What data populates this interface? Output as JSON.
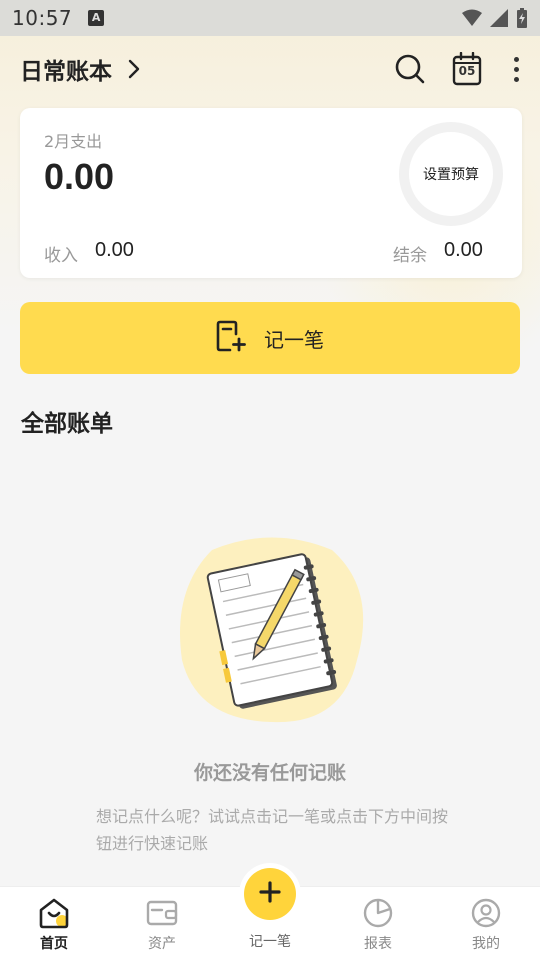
{
  "status_bar": {
    "time": "10:57",
    "notification_badge": "A"
  },
  "header": {
    "book_title": "日常账本",
    "calendar_day": "05"
  },
  "summary": {
    "month_label": "2月支出",
    "expense_amount": "0.00",
    "budget_label": "设置预算",
    "income_label": "收入",
    "income_value": "0.00",
    "balance_label": "结余",
    "balance_value": "0.00"
  },
  "record_button": {
    "label": "记一笔"
  },
  "bills": {
    "section_title": "全部账单",
    "empty_title": "你还没有任何记账",
    "empty_hint": "想记点什么呢？试试点击记一笔或点击下方中间按钮进行快速记账"
  },
  "bottom_nav": {
    "items": [
      {
        "label": "首页",
        "icon": "home-icon",
        "active": true
      },
      {
        "label": "资产",
        "icon": "wallet-icon",
        "active": false
      },
      {
        "label": "记一笔",
        "icon": "plus-icon",
        "active": false
      },
      {
        "label": "报表",
        "icon": "pie-chart-icon",
        "active": false
      },
      {
        "label": "我的",
        "icon": "profile-icon",
        "active": false
      }
    ]
  },
  "colors": {
    "accent": "#ffdb4f",
    "fab": "#ffd43b",
    "text_primary": "#222222",
    "text_secondary": "#999999"
  }
}
